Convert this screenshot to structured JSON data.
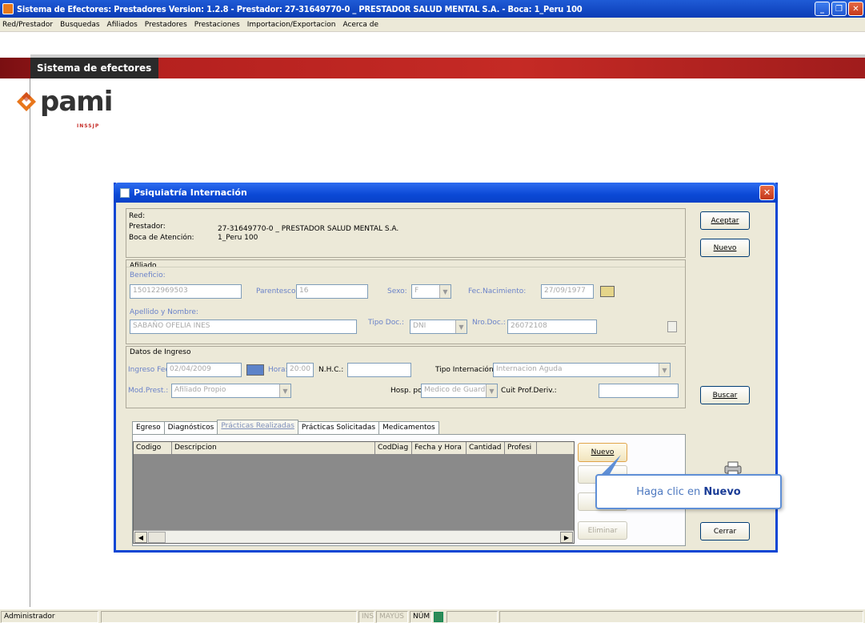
{
  "window": {
    "title": "Sistema de Efectores: Prestadores Version: 1.2.8 - Prestador: 27-31649770-0 _ PRESTADOR SALUD MENTAL S.A. - Boca: 1_Peru 100"
  },
  "menu": [
    "Red/Prestador",
    "Busquedas",
    "Afiliados",
    "Prestadores",
    "Prestaciones",
    "Importacion/Exportacion",
    "Acerca de"
  ],
  "header": {
    "band_title": "Sistema de efectores"
  },
  "logo": {
    "text": "pami",
    "sub": "INSSJP"
  },
  "dialog": {
    "title": "Psiquiatría Internación",
    "red_label": "Red:",
    "prestador_label": "Prestador:",
    "prestador_value": "27-31649770-0 _ PRESTADOR SALUD MENTAL S.A.",
    "boca_label": "Boca de Atención:",
    "boca_value": "1_Peru 100",
    "afiliado_title": "Afiliado",
    "beneficio_label": "Beneficio:",
    "beneficio_value": "150122969503",
    "parentesco_label": "Parentesco:",
    "parentesco_value": "16",
    "sexo_label": "Sexo:",
    "sexo_value": "F",
    "fec_nac_label": "Fec.Nacimiento:",
    "fec_nac_value": "27/09/1977",
    "apellido_label": "Apellido y Nombre:",
    "apellido_value": "SABAÑO OFELIA INES",
    "tipo_doc_label": "Tipo Doc.:",
    "tipo_doc_value": "DNI",
    "nro_doc_label": "Nro.Doc.:",
    "nro_doc_value": "26072108",
    "ingreso_title": "Datos de Ingreso",
    "ingreso_fec_label": "Ingreso Fec.:",
    "ingreso_fec_value": "02/04/2009",
    "hora_label": "Hora:",
    "hora_value": "20:00",
    "nhc_label": "N.H.C.:",
    "nhc_value": "",
    "tipo_int_label": "Tipo Internación:",
    "tipo_int_value": "Internacion Aguda",
    "mod_prest_label": "Mod.Prest.:",
    "mod_prest_value": "Afiliado Propio",
    "hosp_label": "Hosp. por:",
    "hosp_value": "Medico de Guardia",
    "cuit_label": "Cuit Prof.Deriv.:",
    "cuit_value": "",
    "btn_aceptar": "Aceptar",
    "btn_nuevo": "Nuevo",
    "btn_buscar": "Buscar",
    "btn_cerrar": "Cerrar",
    "tabs": [
      "Egreso",
      "Diagnósticos",
      "Prácticas Realizadas",
      "Prácticas Solicitadas",
      "Medicamentos"
    ],
    "grid_columns": [
      "Codigo",
      "Descripcion",
      "CodDiag",
      "Fecha y Hora",
      "Cantidad",
      "Profesi"
    ],
    "grid_btn_nuevo": "Nuevo",
    "grid_btn_eliminar": "Eliminar",
    "tooltip_prefix": "Haga clic en",
    "tooltip_bold": "Nuevo"
  },
  "status": {
    "user": "Administrador",
    "ins": "INS",
    "mayus": "MAYÚS",
    "num": "NÚM"
  }
}
